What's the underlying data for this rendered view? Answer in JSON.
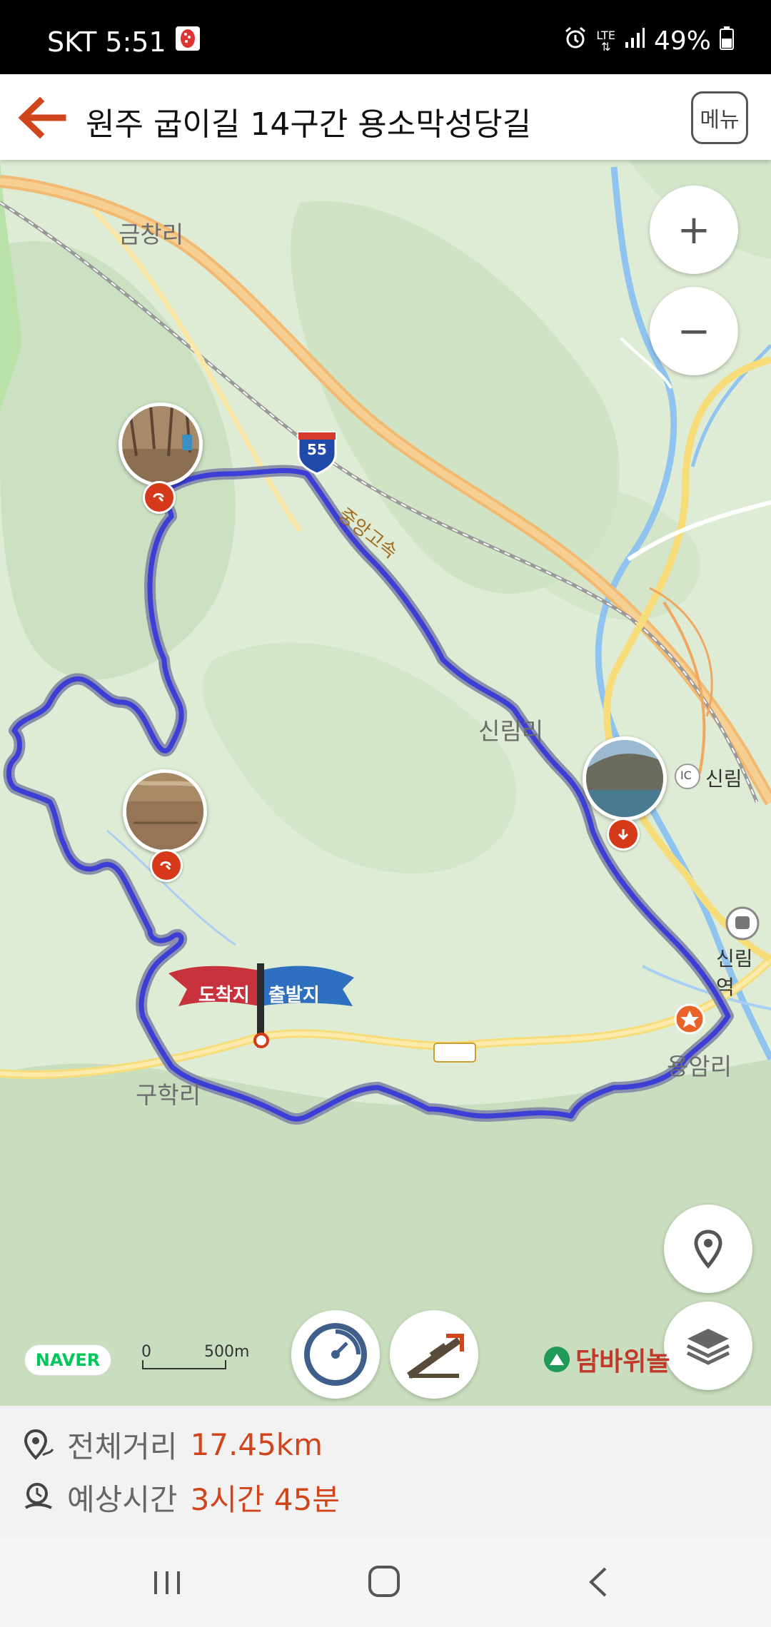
{
  "status": {
    "carrier": "SKT",
    "time": "5:51",
    "network": "LTE",
    "battery": "49%",
    "icons": [
      "app-notification-icon",
      "alarm-icon",
      "lte-icon",
      "signal-icon",
      "battery-icon"
    ]
  },
  "header": {
    "title": "원주 굽이길 14구간 용소막성당길",
    "menu_label": "메뉴",
    "back_icon": "back-arrow-icon"
  },
  "map": {
    "places": {
      "geumchang": "금창리",
      "sinrim": "신림리",
      "ic_badge": "IC",
      "sinrim_ic": "신림",
      "sinrim_station": "신림역",
      "yongam": "용암리",
      "guhak": "구학리",
      "highway": "중앙고속",
      "route_number": "55"
    },
    "flags": {
      "arrival": "도착지",
      "departure": "출발지"
    },
    "controls": {
      "zoom_in": "+",
      "zoom_out": "−"
    },
    "naver": "NAVER",
    "scale": {
      "zero": "0",
      "distance": "500m"
    },
    "brand": "담바위놀"
  },
  "info": {
    "distance_label": "전체거리",
    "distance_value": "17.45km",
    "time_label": "예상시간",
    "time_value": "3시간 45분"
  },
  "colors": {
    "accent": "#d0451b",
    "route": "#3b3fd6",
    "flag_red": "#c8323c",
    "flag_blue": "#2f6fbf"
  }
}
